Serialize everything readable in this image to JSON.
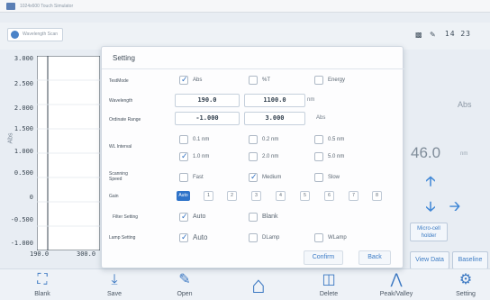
{
  "window": {
    "title": "1024x600 Touch Simulator"
  },
  "header": {
    "home_label": "Wavelength Scan",
    "clock": "14 23"
  },
  "chart_data": {
    "type": "line",
    "ylabel": "Abs",
    "y_ticks": [
      "3.000",
      "2.500",
      "2.000",
      "1.500",
      "1.000",
      "0.500",
      "0",
      "-0.500",
      "-1.000"
    ],
    "x_ticks": [
      "190.0",
      "300.0"
    ],
    "ylim": [
      -1.0,
      3.0
    ],
    "series": []
  },
  "right_panel": {
    "unit_label": "Abs",
    "value": "46.0",
    "value_unit": "nm",
    "micro_line1": "Micro-cell",
    "micro_line2": "holder",
    "view_data": "View Data",
    "baseline": "Baseline"
  },
  "dialog": {
    "title": "Setting",
    "rows": {
      "testmode": "TestMode",
      "wavelength": "Wavelength",
      "ordinate": "Ordinate Range",
      "interval": "WL Interval",
      "speed": "Scanning Speed",
      "gain": "Gain",
      "filter": "Filter Setting",
      "lamp": "Lamp Setting"
    },
    "mode": {
      "abs": "Abs",
      "t": "%T",
      "energy": "Energy"
    },
    "wavelength": {
      "start": "190.0",
      "end": "1100.0",
      "unit": "nm"
    },
    "ordinate": {
      "min": "-1.000",
      "max": "3.000",
      "unit": "Abs"
    },
    "interval": [
      "0.1 nm",
      "0.2 nm",
      "0.5 nm",
      "1.0 nm",
      "2.0 nm",
      "5.0 nm"
    ],
    "speed": {
      "fast": "Fast",
      "medium": "Medium",
      "slow": "Slow"
    },
    "gain": [
      "Auto",
      "1",
      "2",
      "3",
      "4",
      "5",
      "6",
      "7",
      "8"
    ],
    "filter": {
      "auto": "Auto",
      "blank": "Blank"
    },
    "lamp": {
      "auto": "Auto",
      "dlamp": "DLamp",
      "wlamp": "WLamp"
    },
    "confirm": "Confirm",
    "back": "Back"
  },
  "toolbar": {
    "items": [
      "Blank",
      "Save",
      "Open",
      "",
      "Delete",
      "Peak/Valley",
      "Setting"
    ]
  },
  "colors": {
    "accent": "#2f73c9",
    "panel": "#eef2f7"
  }
}
